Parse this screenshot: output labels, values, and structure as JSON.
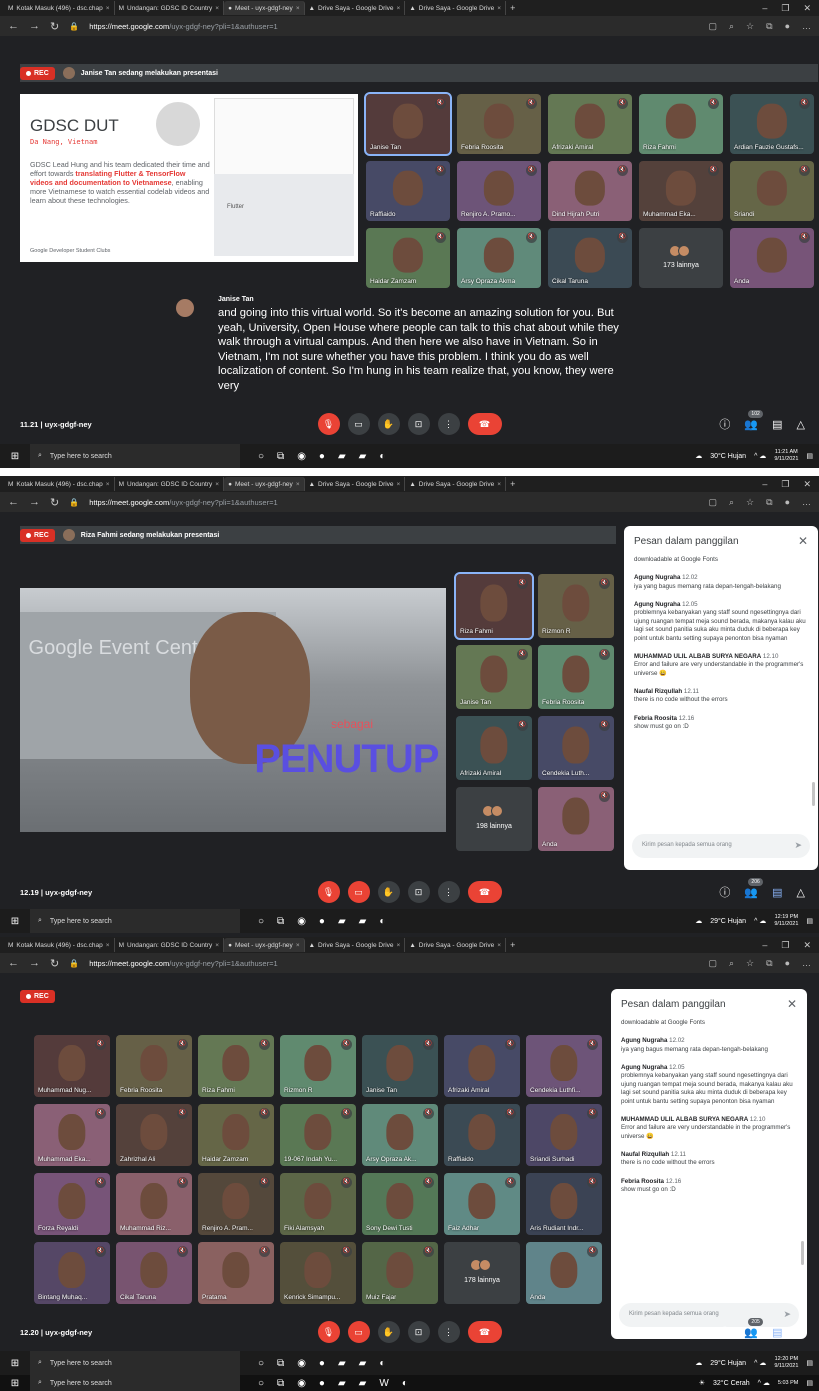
{
  "browser": {
    "tabs": [
      "Kotak Masuk (496) - dsc.chap",
      "Undangan: GDSC ID Country",
      "Meet - uyx-gdgf-ney",
      "Drive Saya - Google Drive",
      "Drive Saya - Google Drive"
    ],
    "url_host": "https://meet.google.com",
    "url_path": "/uyx-gdgf-ney?pli=1&authuser=1"
  },
  "meet_code": "uyx-gdgf-ney",
  "rec_label": "REC",
  "panel1": {
    "presenting": "Janise Tan sedang melakukan presentasi",
    "slide": {
      "title": "GDSC DUT",
      "subtitle": "Da Nang, Vietnam",
      "body_start": "GDSC Lead Hung and his team dedicated their time and effort towards ",
      "body_bold": "translating Flutter & TensorFlow videos and documentation to Vietnamese",
      "body_end": ", enabling more Vietnamese to watch essential codelab videos and learn about these technologies.",
      "footer": "Google Developer Student Clubs",
      "flutter_label": "Flutter"
    },
    "tiles": [
      "Janise Tan",
      "Febria Roosita",
      "Afrizaki Amiral",
      "Riza Fahmi",
      "Ardian Fauzie Gustafs...",
      "Raffiaido",
      "Renjiro A. Pramo...",
      "Dind Hijrah Putri",
      "Muhammad Eka...",
      "Sriandi",
      "Haidar Zamzam",
      "Arsy Opraza Akma",
      "Cikal Taruna",
      "173 lainnya",
      "Anda"
    ],
    "caption_speaker": "Janise Tan",
    "caption_text": "and going into this virtual world. So it's become an amazing solution for you. But yeah, University, Open House where people can talk to this chat about while they walk through a virtual campus. And then here we also have in Vietnam. So in Vietnam, I'm not sure whether you have this problem. I think you do as well localization of content. So I'm hung in his team realize that, you know, they were very",
    "time": "11.21",
    "people_count": "102",
    "clock_time": "11:21 AM",
    "clock_date": "9/11/2021",
    "weather": "30°C Hujan"
  },
  "panel2": {
    "presenting": "Riza Fahmi sedang melakukan presentasi",
    "stage_sign": "Google Event Center",
    "stage_sebagai": "sebagai",
    "stage_penutup": "PENUTUP",
    "tiles": [
      "Riza Fahmi",
      "Rizmon R",
      "Janise Tan",
      "Febria Roosita",
      "Afrizaki Amiral",
      "Cendekia Luth...",
      "198 lainnya",
      "Anda"
    ],
    "time": "12.19",
    "people_count": "206",
    "clock_time": "12:19 PM",
    "clock_date": "9/11/2021",
    "weather": "29°C Hujan"
  },
  "chat": {
    "title": "Pesan dalam panggilan",
    "intro": "downloadable at Google Fonts",
    "messages": [
      {
        "who": "Agung Nugraha",
        "time": "12.02",
        "text": "iya yang bagus memang rata depan-tengah-belakang"
      },
      {
        "who": "Agung Nugraha",
        "time": "12.05",
        "text": "problemnya kebanyakan yang staff sound ngesettingnya dari ujung ruangan tempat meja sound berada, makanya kalau aku lagi set sound panitia suka aku minta duduk di beberapa key point untuk bantu setting supaya penonton bisa nyaman"
      },
      {
        "who": "MUHAMMAD ULIL ALBAB SURYA NEGARA",
        "time": "12.10",
        "text": "Error and failure are very understandable in the programmer's universe 😀"
      },
      {
        "who": "Naufal Rizqullah",
        "time": "12.11",
        "text": "there is no code without the errors"
      },
      {
        "who": "Febria Roosita",
        "time": "12.16",
        "text": "show must go on :D"
      }
    ],
    "placeholder": "Kirim pesan kepada semua orang"
  },
  "panel3": {
    "tiles": [
      "Muhammad Nug...",
      "Febria Roosita",
      "Riza Fahmi",
      "Rizmon R",
      "Janise Tan",
      "Afrizaki Amiral",
      "Cendekia Luthfi...",
      "Muhammad Eka...",
      "Zahrizhal Ali",
      "Haidar Zamzam",
      "19-067 Indah Yu...",
      "Arsy Opraza Ak...",
      "Raffiaido",
      "Sriandi Surhadi",
      "Forza Reyaldi",
      "Muhammad Riz...",
      "Renjiro A. Pram...",
      "Fiki Alamsyah",
      "Sony Dewi Tusti",
      "Faiz Adhar",
      "Aris Rudiant Indr...",
      "Bintang Muhaq...",
      "Cikal Taruna",
      "Pratama",
      "Kenrick Simampu...",
      "Muiz Fajar",
      "178 lainnya",
      "Anda"
    ],
    "time": "12.20",
    "people_count": "205",
    "clock_time": "12:20 PM",
    "clock_date": "9/11/2021",
    "weather": "29°C Hujan",
    "extra_clock_time": "5:03 PM",
    "extra_weather": "32°C Cerah"
  },
  "taskbar_search": "Type here to search",
  "colors": {
    "meet_bg": "#202124",
    "tile": "#3c4043",
    "red": "#ea4335",
    "accent": "#8ab4f8"
  }
}
